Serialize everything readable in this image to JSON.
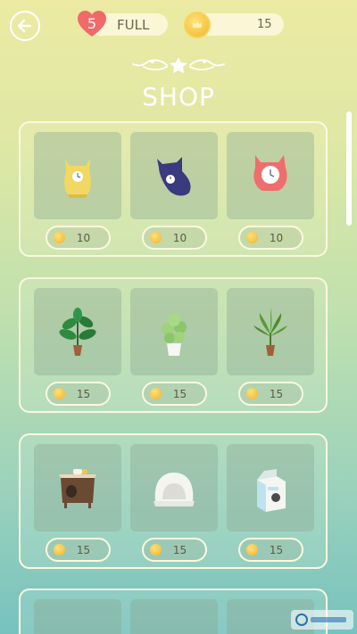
{
  "header": {
    "lives": "5",
    "lives_status": "FULL",
    "coin_balance": "15"
  },
  "shop": {
    "title": "SHOP",
    "rows": [
      {
        "items": [
          {
            "icon": "yellow-cat-clock-icon",
            "price": "10"
          },
          {
            "icon": "blue-cat-clock-icon",
            "price": "10"
          },
          {
            "icon": "red-cat-clock-icon",
            "price": "10"
          }
        ]
      },
      {
        "items": [
          {
            "icon": "fiddle-leaf-plant-icon",
            "price": "15"
          },
          {
            "icon": "pothos-plant-icon",
            "price": "15"
          },
          {
            "icon": "palm-plant-icon",
            "price": "15"
          }
        ]
      },
      {
        "items": [
          {
            "icon": "cat-cabinet-icon",
            "price": "15"
          },
          {
            "icon": "cat-bed-icon",
            "price": "15"
          },
          {
            "icon": "milk-carton-box-icon",
            "price": "15"
          }
        ]
      }
    ]
  },
  "colors": {
    "accent_coin": "#f1b62a",
    "heart": "#f06a6a",
    "panel_border": "#fbf9e0"
  }
}
